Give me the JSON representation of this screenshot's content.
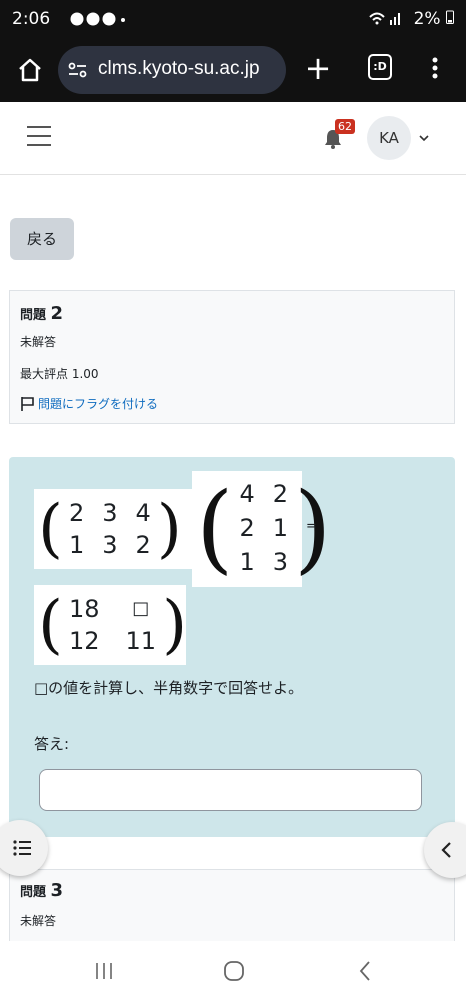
{
  "status_bar": {
    "time": "2:06",
    "notification_icons": [
      "line-icon",
      "chat-icon",
      "line-icon",
      "dot"
    ],
    "battery": "2%"
  },
  "browser": {
    "url": "clms.kyoto-su.ac.jp",
    "tabs_label": ":D"
  },
  "header": {
    "notification_count": "62",
    "user_initials": "KA"
  },
  "back_button": "戻る",
  "question2": {
    "label": "問題",
    "number": "2",
    "state": "未解答",
    "max_grade": "最大評点 1.00",
    "flag_label": "問題にフラグを付ける"
  },
  "question_content": {
    "matrix_a": [
      [
        "2",
        "3",
        "4"
      ],
      [
        "1",
        "3",
        "2"
      ]
    ],
    "matrix_b": [
      [
        "4",
        "2"
      ],
      [
        "2",
        "1"
      ],
      [
        "1",
        "3"
      ]
    ],
    "equals": "=",
    "matrix_result": [
      [
        "18",
        "□"
      ],
      [
        "12",
        "11"
      ]
    ],
    "prompt": "□の値を計算し、半角数字で回答せよ。",
    "answer_label": "答え:",
    "answer_value": ""
  },
  "question3": {
    "label": "問題",
    "number": "3",
    "state": "未解答"
  },
  "colors": {
    "content_bg": "#cee6ea",
    "link": "#0f6cbf",
    "badge": "#ca3120"
  }
}
